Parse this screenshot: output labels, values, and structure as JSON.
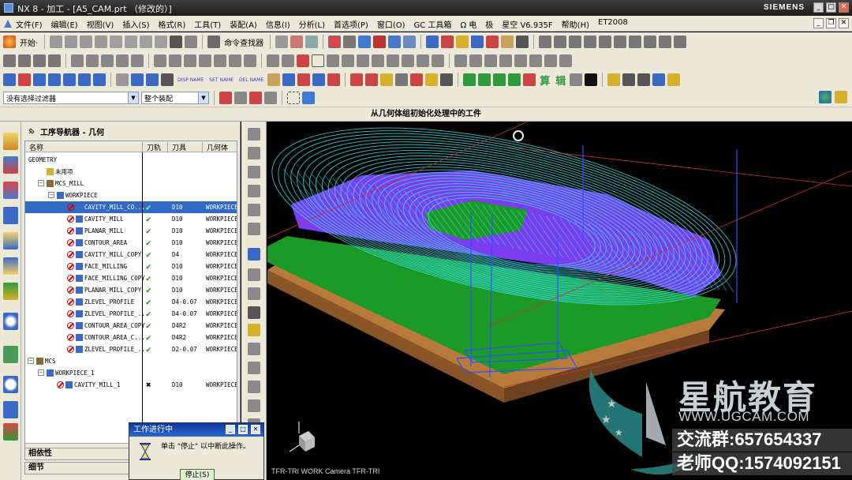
{
  "window": {
    "title": "NX 8 - 加工 - [A5_CAM.prt （修改的）]",
    "brand": "SIEMENS",
    "min": "_",
    "max": "□",
    "close": "✕"
  },
  "menubar": {
    "items": [
      "文件(F)",
      "编辑(E)",
      "视图(V)",
      "插入(S)",
      "格式(R)",
      "工具(T)",
      "装配(A)",
      "信息(I)",
      "分析(L)",
      "首选项(P)",
      "窗口(O)",
      "GC 工具箱",
      "Ω 电",
      "极",
      "星空 V6.935F",
      "帮助(H)",
      "ET2008"
    ],
    "mdi_min": "_",
    "mdi_restore": "❐",
    "mdi_close": "✕"
  },
  "toolbar": {
    "start_label": "开始·",
    "command_finder": "命令查找器",
    "filter_value": "没有选择过滤器",
    "assembly_value": "整个装配",
    "disp_name": "DISP NAME",
    "set_name": "SET NAME",
    "del_name": "DEL NAME",
    "cn_buttons": [
      "算",
      "辑"
    ]
  },
  "cue_line": "从几何体组初始化处理中的工件",
  "navigator": {
    "title": "工序导航器 - 几何",
    "columns": [
      "名称",
      "刀轨",
      "刀具",
      "几何体"
    ],
    "rows": [
      {
        "name": "GEOMETRY",
        "level": 0,
        "kind": "root",
        "path": "",
        "tool": "",
        "geom": ""
      },
      {
        "name": "未用项",
        "level": 1,
        "kind": "folder",
        "path": "",
        "tool": "",
        "geom": ""
      },
      {
        "name": "MCS_MILL",
        "level": 1,
        "kind": "mcs",
        "path": "",
        "tool": "",
        "geom": ""
      },
      {
        "name": "WORKPIECE",
        "level": 2,
        "kind": "workpiece",
        "path": "",
        "tool": "",
        "geom": ""
      },
      {
        "name": "CAVITY_MILL_CO...",
        "level": 3,
        "kind": "op",
        "path": "✔",
        "tool": "D10",
        "geom": "WORKPIECE",
        "selected": true
      },
      {
        "name": "CAVITY_MILL",
        "level": 3,
        "kind": "op",
        "path": "✔",
        "tool": "D10",
        "geom": "WORKPIECE"
      },
      {
        "name": "PLANAR_MILL",
        "level": 3,
        "kind": "op",
        "path": "✔",
        "tool": "D10",
        "geom": "WORKPIECE"
      },
      {
        "name": "CONTOUR_AREA",
        "level": 3,
        "kind": "op",
        "path": "✔",
        "tool": "D10",
        "geom": "WORKPIECE"
      },
      {
        "name": "CAVITY_MILL_COPY",
        "level": 3,
        "kind": "op",
        "path": "✔",
        "tool": "D4",
        "geom": "WORKPIECE"
      },
      {
        "name": "FACE_MILLING",
        "level": 3,
        "kind": "op",
        "path": "✔",
        "tool": "D10",
        "geom": "WORKPIECE"
      },
      {
        "name": "FACE_MILLING_COPY",
        "level": 3,
        "kind": "op",
        "path": "✔",
        "tool": "D10",
        "geom": "WORKPIECE"
      },
      {
        "name": "PLANAR_MILL_COPY",
        "level": 3,
        "kind": "op",
        "path": "✔",
        "tool": "D10",
        "geom": "WORKPIECE"
      },
      {
        "name": "ZLEVEL_PROFILE",
        "level": 3,
        "kind": "op",
        "path": "✔",
        "tool": "D4-0.07",
        "geom": "WORKPIECE"
      },
      {
        "name": "ZLEVEL_PROFILE_...",
        "level": 3,
        "kind": "op",
        "path": "✔",
        "tool": "D4-0.07",
        "geom": "WORKPIECE"
      },
      {
        "name": "CONTOUR_AREA_COPY",
        "level": 3,
        "kind": "op",
        "path": "✔",
        "tool": "D4R2",
        "geom": "WORKPIECE"
      },
      {
        "name": "CONTOUR_AREA_C...",
        "level": 3,
        "kind": "op",
        "path": "✔",
        "tool": "D4R2",
        "geom": "WORKPIECE"
      },
      {
        "name": "ZLEVEL_PROFILE_...",
        "level": 3,
        "kind": "op",
        "path": "✔",
        "tool": "D2-0.07",
        "geom": "WORKPIECE"
      },
      {
        "name": "MCS",
        "level": 0,
        "kind": "mcs",
        "path": "",
        "tool": "",
        "geom": ""
      },
      {
        "name": "WORKPIECE_1",
        "level": 1,
        "kind": "workpiece",
        "path": "",
        "tool": "",
        "geom": ""
      },
      {
        "name": "CAVITY_MILL_1",
        "level": 2,
        "kind": "op",
        "path": "✖",
        "tool": "D10",
        "geom": "WORKPIECE"
      }
    ],
    "dependencies": "相依性",
    "details": "细节"
  },
  "viewport": {
    "label": "TFR-TRI WORK Camera TFR-TRI",
    "colors": {
      "toolpath": "#36e0e8",
      "part": "#7a3df0",
      "stock_green": "#1b9a27",
      "base": "#b87a3a",
      "feed": "#3050ff"
    }
  },
  "dialog": {
    "title": "工作进行中",
    "message": "单击 \"停止\" 以中断此操作。",
    "stop_button": "停止(S)"
  },
  "watermark": {
    "name": "星航教育",
    "url": "WWW.UGCAM.COM",
    "group": "交流群:657654337",
    "qq": "老师QQ:1574092151"
  }
}
